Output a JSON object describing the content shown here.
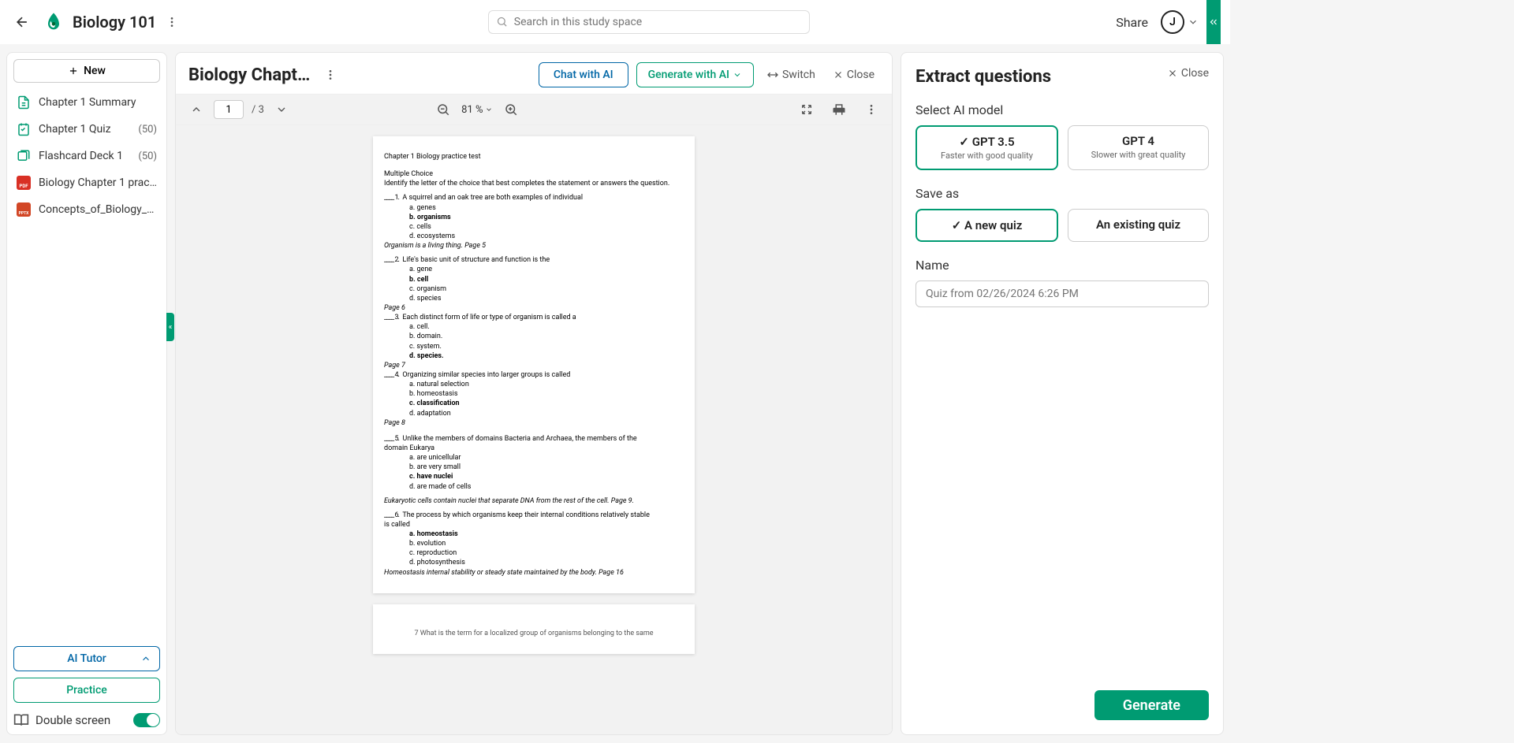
{
  "header": {
    "title": "Biology 101",
    "search_placeholder": "Search in this study space",
    "share": "Share",
    "avatar": "J"
  },
  "sidebar": {
    "new_btn": "New",
    "items": [
      {
        "label": "Chapter 1 Summary",
        "type": "doc",
        "count": ""
      },
      {
        "label": "Chapter 1 Quiz",
        "type": "quiz",
        "count": "(50)"
      },
      {
        "label": "Flashcard Deck 1",
        "type": "flash",
        "count": "(50)"
      },
      {
        "label": "Biology Chapter 1 practice t...",
        "type": "pdf",
        "count": ""
      },
      {
        "label": "Concepts_of_Biology_Chap...",
        "type": "pptx",
        "count": ""
      }
    ],
    "ai_tutor": "AI Tutor",
    "practice": "Practice",
    "double_screen": "Double screen"
  },
  "center": {
    "doc_title": "Biology Chapter...",
    "chat_ai": "Chat with AI",
    "generate_ai": "Generate with AI",
    "switch": "Switch",
    "close": "Close",
    "toolbar": {
      "page": "1",
      "page_total": "/ 3",
      "zoom": "81 %"
    },
    "document": {
      "heading": "Chapter 1 Biology practice test",
      "section": "Multiple Choice",
      "instruction": "Identify the letter of the choice that best completes the statement or answers the question.",
      "q1": {
        "num": "____   1.",
        "text": "A squirrel and an oak tree are both examples of individual",
        "a": "a.   genes",
        "b": "b.   organisms",
        "c": "c.   cells",
        "d": "d.   ecosystems",
        "note": "Organism is a living thing. Page 5"
      },
      "q2": {
        "num": "____   2.",
        "text": "Life's basic unit of structure and function is the",
        "a": "a.   gene",
        "b": "b.   cell",
        "c": "c.   organism",
        "d": "d.   species",
        "note": "Page 6"
      },
      "q3": {
        "num": "____   3.",
        "text": "Each distinct form of life or type of organism is called a",
        "a": "a.   cell.",
        "b": "b.   domain.",
        "c": "c.   system.",
        "d": "d.   species.",
        "note": "Page 7"
      },
      "q4": {
        "num": "____   4.",
        "text": "Organizing similar species into larger groups is called",
        "a": "a.   natural selection",
        "b": "b.   homeostasis",
        "c": "c.   classification",
        "d": "d.   adaptation",
        "note": "Page 8"
      },
      "q5": {
        "num": "____   5.",
        "text": "Unlike the members of domains Bacteria and Archaea, the members of the",
        "text2": "domain Eukarya",
        "a": "a.   are unicellular",
        "b": "b.   are very small",
        "c": "c.   have nuclei",
        "d": "d.   are made of cells",
        "note": "Eukaryotic cells contain nuclei that separate DNA from the rest of the cell. Page 9."
      },
      "q6": {
        "num": "____   6.",
        "text": "The process by which organisms keep their internal conditions relatively stable",
        "text2": "is called",
        "a": "a.   homeostasis",
        "b": "b.   evolution",
        "c": "c.   reproduction",
        "d": "d.   photosynthesis",
        "note": "Homeostasis internal stability or steady state maintained by the body. Page 16"
      },
      "page2_hint": "7   What is the term for a localized group of organisms belonging to the same"
    }
  },
  "right": {
    "title": "Extract questions",
    "close": "Close",
    "select_model": "Select AI model",
    "models": [
      {
        "main": "✓ GPT 3.5",
        "sub": "Faster with good quality"
      },
      {
        "main": "GPT 4",
        "sub": "Slower with great quality"
      }
    ],
    "save_as": "Save as",
    "save_opts": [
      {
        "main": "✓  A new quiz"
      },
      {
        "main": "An existing quiz"
      }
    ],
    "name_label": "Name",
    "name_placeholder": "Quiz from 02/26/2024 6:26 PM",
    "generate": "Generate"
  }
}
